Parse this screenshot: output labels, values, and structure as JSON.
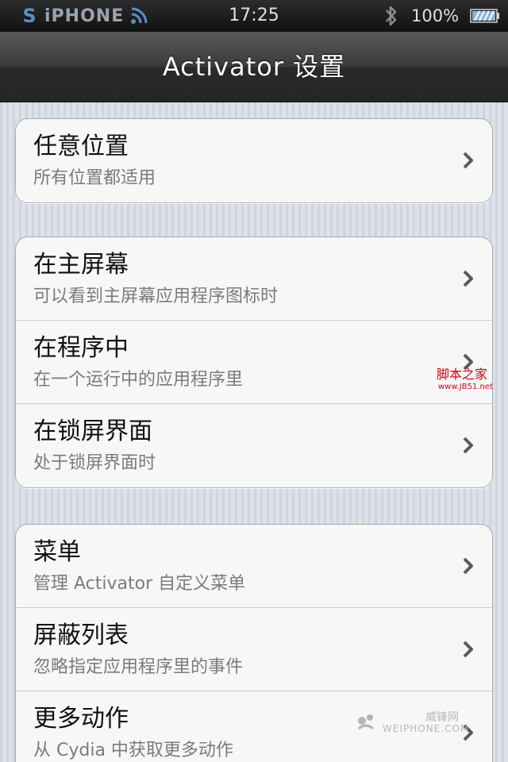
{
  "status_bar": {
    "carrier_badge": "S",
    "carrier_name": "iPHONE",
    "time": "17:25",
    "battery": "100%",
    "icons": [
      "rss-icon",
      "bluetooth-icon",
      "battery-icon"
    ]
  },
  "nav": {
    "title": "Activator 设置"
  },
  "groups": [
    {
      "cells": [
        {
          "title": "任意位置",
          "subtitle": "所有位置都适用"
        }
      ]
    },
    {
      "cells": [
        {
          "title": "在主屏幕",
          "subtitle": "可以看到主屏幕应用程序图标时"
        },
        {
          "title": "在程序中",
          "subtitle": "在一个运行中的应用程序里"
        },
        {
          "title": "在锁屏界面",
          "subtitle": "处于锁屏界面时"
        }
      ]
    },
    {
      "cells": [
        {
          "title": "菜单",
          "subtitle": "管理 Activator 自定义菜单"
        },
        {
          "title": "屏蔽列表",
          "subtitle": "忽略指定应用程序里的事件"
        },
        {
          "title": "更多动作",
          "subtitle": "从 Cydia 中获取更多动作"
        }
      ]
    }
  ],
  "watermarks": {
    "site_name": "脚本之家",
    "site_url": "www.JB51.net",
    "brand_cn": "威锋网",
    "brand_en": "WEIPHONE.COM"
  },
  "colors": {
    "accent_blue": "#5b8fc9",
    "watermark_red": "#d0021b"
  }
}
